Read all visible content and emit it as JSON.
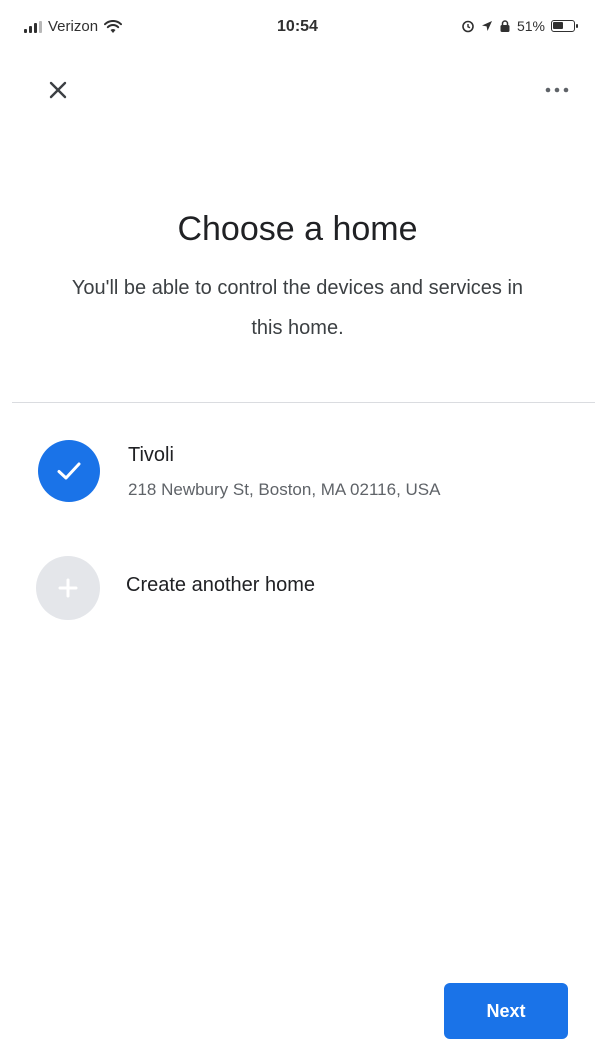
{
  "status_bar": {
    "carrier": "Verizon",
    "time": "10:54",
    "battery_percent": "51%",
    "battery_level": 0.51,
    "icons": [
      "signal-icon",
      "wifi-icon",
      "alarm-icon",
      "location-icon",
      "lock-rotation-icon",
      "battery-icon"
    ]
  },
  "app_bar": {
    "close_icon": "close-icon",
    "more_icon": "more-horizontal-icon"
  },
  "header": {
    "title": "Choose a home",
    "subtitle": "You'll be able to control the devices and services in this home."
  },
  "homes": [
    {
      "name": "Tivoli",
      "address": "218 Newbury St, Boston, MA 02116, USA",
      "selected": true,
      "icon": "check-icon"
    }
  ],
  "create_home": {
    "label": "Create another home",
    "icon": "plus-icon"
  },
  "footer": {
    "next_label": "Next"
  },
  "colors": {
    "accent": "#1a73e8",
    "text_primary": "#202124",
    "text_secondary": "#5f6368",
    "divider": "#dadce0"
  }
}
